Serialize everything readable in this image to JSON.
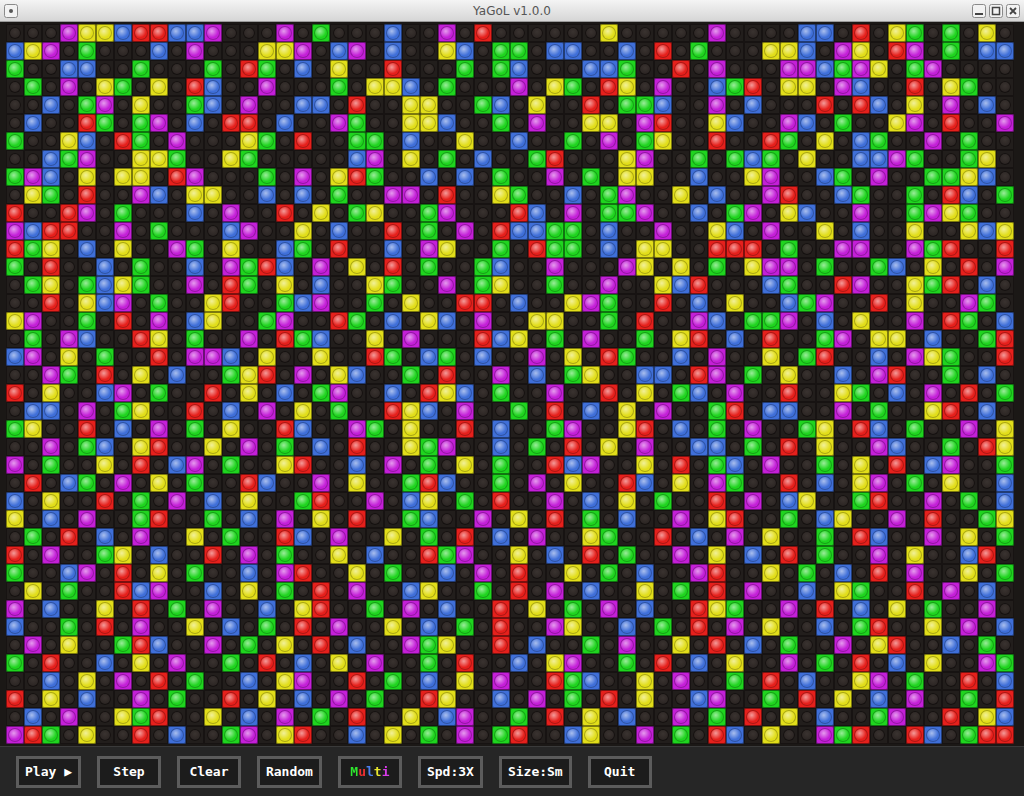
{
  "window": {
    "title": "YaGoL v1.0.0"
  },
  "grid": {
    "palette": {
      "r": "#e6201c",
      "g": "#1fd51f",
      "b": "#3f6fd9",
      "y": "#e2de1a",
      "m": "#c41fd8"
    },
    "rows": [
      "...myybrrbbm...m.g...b..m.r......y.....m....bb.r.yg.g.y.",
      "bym.g...b.m...yym.bm.b..yb.gg.bb..b.r.g...yyb.my.rm.g.bb",
      "g..bb..g...g.rg.b.y..r...g.gb...bbg..r.m...mmbgmy.gm....",
      ".g.m.yg.y.rb..m...g.yyb.g...m.yg.ry.m..bgr.yy.mb..r.yg..",
      "..b.gm.y..gb.m..bb.r..yy..gb.y..r.ggb..m.b...r.rb.y.m.b.",
      ".b..rg.gm.b.rr.b..mg..yyb..g.m..yy.mr..yb..mb.g..ym.r..m",
      "g..yb.rg.m...yg.r..gg.b..y..b..g.m.gy..r..rg.y.bg..m.g..",
      "..bgm..yyg..yg.....bm.y.g.b..gr...ym..g.gbg.y..bbmg..gy.",
      "gmb.y.yy.rm...g.m.yrg..b.b.g..m.g.yy..b..ym..bg.m..ggyb.",
      ".yg.r..mb.yy..b.b.g..mm.r..yg..b.gm..y.b..mr..bg..g.rb.g",
      "r..rm.g...b.m..r.y.gy..gm...rb.m.ggm..b.gm.yb..m..gmyg..",
      "mbrr..m.g...bm..y.b..r.g.m.rbbgg.b..m..yb.m..y.b..y..yby",
      "rgy.b.y..mg.y..bg.r..b.my..g.rgg.b.yy..rrr.g..mm..mgr..r",
      "g.r..b.g..b.mgrb.m.y.r.g..gb..m...my.y.g.ymm.g..gb.y.r.m",
      ".gy.gbyg..m.rg.y.b..yg..m.gy..g..m..ybr...bg..rm..ygr.b.",
      "..r.ybm.g..yr..gbm..g.y..rr.b..ymg..r.b.y..bgm..r.y..mg.",
      "ym..g.r.m.by..gm..rg.b.yb.m..yy..g.r..mb.ggm.b.y..m.rg.b",
      ".g.mb..ry.g..m.rgb..y.m...rby.g.m..g.yr.b.r..gm.yy.b..gr",
      "bm.y.g..r.mmb.y..y..rg.bg.b..m.y.rg..b.m..y.gr..b.myg..r",
      "..mg.r.y.b..gyr.m.yb..g.r..m.b.gy..bb.rm.g.y..b.mr..g.b.",
      "r.y..bm.g..r.y.b.gm..b.ryb.g..m..r.y.gb.m..r..yg.b.m.r.g",
      ".bb.m.gy..r.b.m.y.g..ryb.m..g.r.b.y.m..gr.bb..m.g..yr.b.",
      "gy..r.b.m.g.y..rb..mg.y..r.b..gm..yr.b.g.m..gy.rb.g..m.y",
      "..m.gb.yr..y.m.g.b.r..ygm..b.g.r.y.m..bb.g.r.y..mb..g.ry",
      "m.g..y.r.bm.g..yr..b.m.g.y.g..rbm..y.r.gb.m..g.y.r.bm..g",
      ".r.bg.m.y.g..rb..m.y..grb..g.m.y..rb.y.mg..r.b.ym.g.y..b",
      "b.y..r.g.m.b.y..gr..m.by.g.r..m.b.y.g..r.m.by..gr..m.g.b",
      "y.b.m..gr..g.b.m.y.r..gb..m.y.r.g.b..m.yr..g.by..m.r..gy",
      ".g.r.b.m..y.g..rb.m..y.g.r.b.m..yg..r.b.m.y..g.rb..m.y.g",
      "r.m..gy.b..r.m.g..y.b..rgm..y.b.r.g..m.y.b.r.g..m.y..br.",
      "g..bm.r.y.g..b.mr..y.g..b.m.r..y.g.b..mr..y.g.b.r.m..y.g",
      ".y.g..rbm..b.y.g.r.m..by..g.r.m.b..y.g.r.m..b.yg..r.m.b.",
      "m.b..y.r.g.m..b.yr..g.m.b..r.y.g.m.b..ryg..m.r.b.y.g..m.",
      "b..g.r.m..y.b.g.r.m..y.b.g.r..my..b.g.r.m.y..b.gr..y.m.b",
      ".m.y..grb..m.g.y.r.b..mgy..r.b..g.m..y.r.b.g..m.yr..b.g.",
      "g.r..b.y.m..g.r.b.y.m..g.r..b.ym..g.r.b.y..m.g.r.b.y..mg",
      "..b.y.m.r.g..b.ym..r.g.b.y.m..rgb..y.m..g.r.b..ym.g..r.b",
      "r.y.b..m.g..r.y.b.m.g..ry..b.m.g.r.y..bm..g.r.y.b.m..g.r",
      ".b.m..ygr..y.b.m.g.r..y.bm..g.r.y.b..m.g.r.y.b..gm..r.yb",
      "mrg.y..r.b..gm.yr..b.y.g.m.gr..by..m.g.rb.y..mgr..rb.grr"
    ]
  },
  "toolbar": {
    "buttons": [
      {
        "label": "Play ▶"
      },
      {
        "label": "Step"
      },
      {
        "label": "Clear"
      },
      {
        "label": "Random"
      },
      {
        "label": "Multi",
        "label_colors": [
          "#2ee82e",
          "#ec3030",
          "#4a7ef0",
          "#e8e62e",
          "#d83ae8"
        ]
      },
      {
        "label": "Spd:3X"
      },
      {
        "label": "Size:Sm"
      },
      {
        "label": "Quit"
      }
    ]
  }
}
